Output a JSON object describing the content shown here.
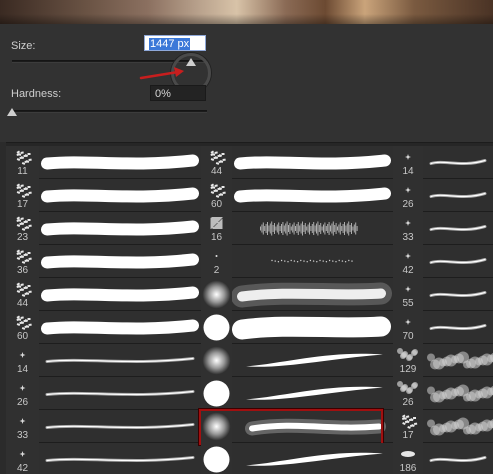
{
  "panel": {
    "size_label": "Size:",
    "size_value": "1447 px",
    "size_level": 0.92,
    "hardness_label": "Hardness:",
    "hardness_value": "0%",
    "hardness_level": 0.0
  },
  "colors": {
    "annotation": "#c81e1e",
    "selection": "#3b78d8"
  },
  "brush_columns": [
    {
      "column": 1,
      "items": [
        {
          "size": "11",
          "tip": "scatter-tip",
          "stroke": "thick-wave"
        },
        {
          "size": "17",
          "tip": "scatter-tip",
          "stroke": "thick-wave"
        },
        {
          "size": "23",
          "tip": "scatter-tip",
          "stroke": "thick-wave"
        },
        {
          "size": "36",
          "tip": "scatter-tip",
          "stroke": "thick-wave"
        },
        {
          "size": "44",
          "tip": "scatter-tip",
          "stroke": "thick-wave"
        },
        {
          "size": "60",
          "tip": "scatter-tip",
          "stroke": "thick-wave"
        },
        {
          "size": "14",
          "tip": "star-tip",
          "stroke": "thin-wave"
        },
        {
          "size": "26",
          "tip": "star-tip",
          "stroke": "thin-wave"
        },
        {
          "size": "33",
          "tip": "star-tip",
          "stroke": "thin-wave"
        },
        {
          "size": "42",
          "tip": "star-tip",
          "stroke": "thin-wave"
        }
      ]
    },
    {
      "column": 2,
      "items": [
        {
          "size": "44",
          "tip": "scatter-tip",
          "stroke": "thick-wave"
        },
        {
          "size": "60",
          "tip": "scatter-tip",
          "stroke": "thick-wave"
        },
        {
          "size": "16",
          "tip": "square-tip",
          "stroke": "bristle-stroke"
        },
        {
          "size": "2",
          "tip": "dot-tip",
          "stroke": "dotted-stroke"
        },
        {
          "size": "",
          "tip": "soft-round-tip",
          "stroke": "soft-stroke"
        },
        {
          "size": "",
          "tip": "hard-round-tip",
          "stroke": "hard-stroke"
        },
        {
          "size": "",
          "tip": "soft-round-tip",
          "stroke": "taper-stroke"
        },
        {
          "size": "",
          "tip": "hard-round-tip",
          "stroke": "taper-stroke"
        },
        {
          "size": "",
          "tip": "soft-round-tip",
          "stroke": "soft-taper-stroke",
          "selected": true
        },
        {
          "size": "",
          "tip": "hard-round-tip",
          "stroke": "hard-taper-stroke"
        }
      ]
    },
    {
      "column": 3,
      "items": [
        {
          "size": "14",
          "tip": "star-tip",
          "stroke": "thin-wave"
        },
        {
          "size": "26",
          "tip": "star-tip",
          "stroke": "thin-wave"
        },
        {
          "size": "33",
          "tip": "star-tip",
          "stroke": "thin-wave"
        },
        {
          "size": "42",
          "tip": "star-tip",
          "stroke": "thin-wave"
        },
        {
          "size": "55",
          "tip": "star-tip",
          "stroke": "thin-wave"
        },
        {
          "size": "70",
          "tip": "star-tip",
          "stroke": "thin-wave"
        },
        {
          "size": "129",
          "tip": "cloud-tip",
          "stroke": "cloud-stroke"
        },
        {
          "size": "26",
          "tip": "cloud-tip",
          "stroke": "cloud-stroke"
        },
        {
          "size": "17",
          "tip": "scatter-tip",
          "stroke": "cloud-stroke"
        },
        {
          "size": "186",
          "tip": "oval-tip",
          "stroke": "thin-wave"
        }
      ]
    }
  ]
}
